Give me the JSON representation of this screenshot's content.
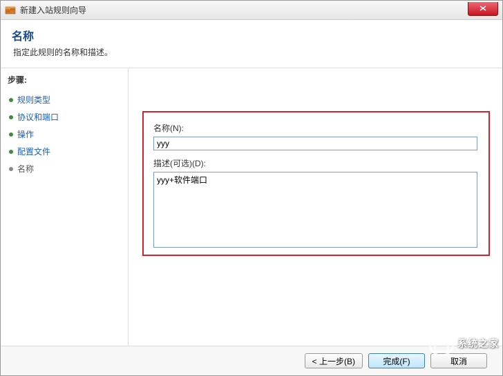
{
  "window": {
    "title": "新建入站规则向导"
  },
  "header": {
    "title": "名称",
    "subtitle": "指定此规则的名称和描述。"
  },
  "sidebar": {
    "steps_label": "步骤:",
    "items": [
      {
        "label": "规则类型",
        "active_link": true
      },
      {
        "label": "协议和端口",
        "active_link": true
      },
      {
        "label": "操作",
        "active_link": true
      },
      {
        "label": "配置文件",
        "active_link": true
      },
      {
        "label": "名称",
        "active_link": false
      }
    ]
  },
  "form": {
    "name_label": "名称(N):",
    "name_value": "yyy",
    "desc_label": "描述(可选)(D):",
    "desc_value": "yyy+软件端口"
  },
  "footer": {
    "back": "< 上一步(B)",
    "finish": "完成(F)",
    "cancel": "取消"
  },
  "watermark": {
    "text": "系统之家"
  }
}
